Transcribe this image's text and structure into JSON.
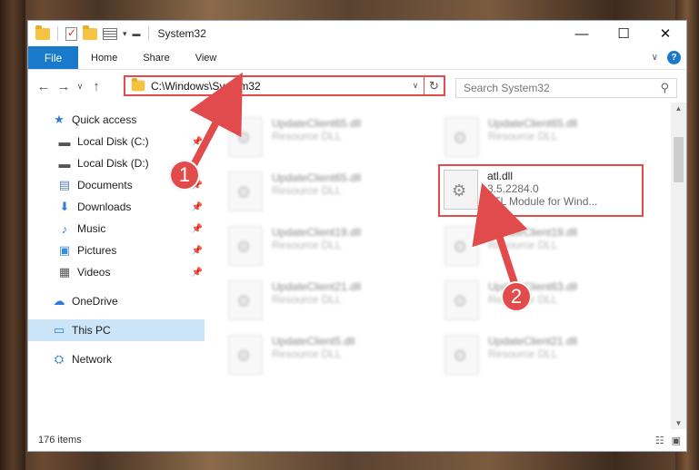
{
  "window": {
    "title": "System32",
    "controls": {
      "minimize": "—",
      "maximize": "☐",
      "close": "✕"
    }
  },
  "ribbon": {
    "file_tab": "File",
    "tabs": [
      "Home",
      "Share",
      "View"
    ],
    "help": "?"
  },
  "navigation": {
    "address_path": "C:\\Windows\\System32",
    "search_placeholder": "Search System32"
  },
  "sidebar": {
    "items": [
      {
        "label": "Quick access",
        "icon": "star-icon",
        "glyph": "★",
        "pinned": false
      },
      {
        "label": "Local Disk (C:)",
        "icon": "drive-icon",
        "glyph": "▬",
        "pinned": true
      },
      {
        "label": "Local Disk (D:)",
        "icon": "drive-icon",
        "glyph": "▬",
        "pinned": false
      },
      {
        "label": "Documents",
        "icon": "documents-icon",
        "glyph": "▤",
        "pinned": true
      },
      {
        "label": "Downloads",
        "icon": "download-icon",
        "glyph": "⬇",
        "pinned": true
      },
      {
        "label": "Music",
        "icon": "music-icon",
        "glyph": "♪",
        "pinned": true
      },
      {
        "label": "Pictures",
        "icon": "pictures-icon",
        "glyph": "▣",
        "pinned": true
      },
      {
        "label": "Videos",
        "icon": "videos-icon",
        "glyph": "▦",
        "pinned": true
      },
      {
        "label": "OneDrive",
        "icon": "cloud-icon",
        "glyph": "☁",
        "pinned": false
      },
      {
        "label": "This PC",
        "icon": "computer-icon",
        "glyph": "▭",
        "pinned": false,
        "selected": true
      },
      {
        "label": "Network",
        "icon": "network-icon",
        "glyph": "⛭",
        "pinned": false
      }
    ]
  },
  "files": [
    {
      "name": "UpdateClient65.dll",
      "sub": "Resource DLL"
    },
    {
      "name": "UpdateClient65.dll",
      "sub": "Resource DLL"
    },
    {
      "name": "UpdateClient65.dll",
      "sub": "Resource DLL"
    },
    {
      "name": "atl.dll",
      "version": "3.5.2284.0",
      "description": "ATL Module for Wind..."
    },
    {
      "name": "UpdateClient19.dll",
      "sub": "Resource DLL"
    },
    {
      "name": "UpdateClient19.dll",
      "sub": "Resource DLL"
    },
    {
      "name": "UpdateClient21.dll",
      "sub": "Resource DLL"
    },
    {
      "name": "UpdateClient63.dll",
      "sub": "Resource DLL"
    },
    {
      "name": "UpdateClient5.dll",
      "sub": "Resource DLL"
    },
    {
      "name": "UpdateClient21.dll",
      "sub": "Resource DLL"
    }
  ],
  "status": {
    "item_count": "176 items"
  },
  "callouts": {
    "first": "1",
    "second": "2"
  },
  "colors": {
    "accent": "#1979ca",
    "highlight": "#e24b4b",
    "selected": "#cce4f7"
  }
}
